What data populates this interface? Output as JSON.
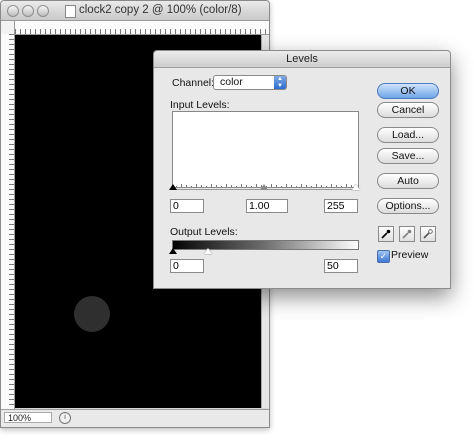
{
  "document_window": {
    "title": "clock2 copy 2 @ 100% (color/8)",
    "zoom": "100%"
  },
  "levels_dialog": {
    "title": "Levels",
    "channel_label": "Channel:",
    "channel_value": "color",
    "input_levels_label": "Input Levels:",
    "input_black": "0",
    "input_gamma": "1.00",
    "input_white": "255",
    "output_levels_label": "Output Levels:",
    "output_black": "0",
    "output_white": "50",
    "buttons": {
      "ok": "OK",
      "cancel": "Cancel",
      "load": "Load...",
      "save": "Save...",
      "auto": "Auto",
      "options": "Options..."
    },
    "preview_label": "Preview",
    "preview_checked": true
  }
}
